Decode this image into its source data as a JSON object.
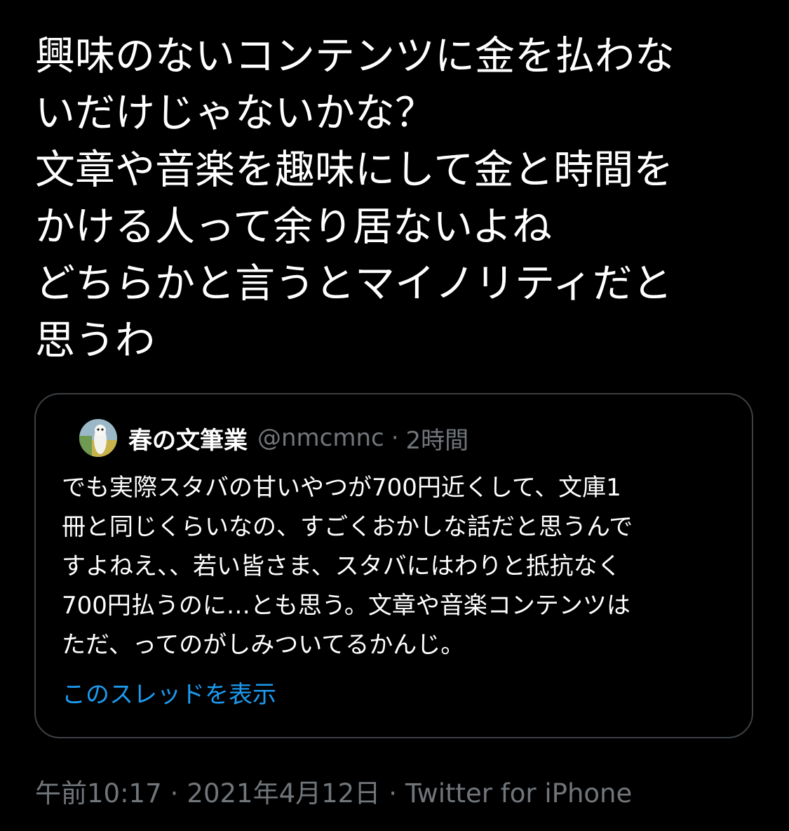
{
  "tweet": {
    "text_lines": [
      "興味のないコンテンツに金を払わな",
      "いだけじゃないかな？",
      "文章や音楽を趣味にして金と時間を",
      "かける人って余り居ないよね",
      "どちらかと言うとマイノリティだと",
      "思うわ"
    ]
  },
  "quote": {
    "author_name": "春の文筆業",
    "handle": "@nmcmnc",
    "separator": "·",
    "time": "2時間",
    "avatar_icon": "avatar-icon",
    "body_lines": [
      "でも実際スタバの甘いやつが700円近くして、文庫1",
      "冊と同じくらいなの、すごくおかしな話だと思うんで",
      "すよねえ、、若い皆さま、スタバにはわりと抵抗なく",
      "700円払うのに…とも思う。文章や音楽コンテンツは",
      "ただ、ってのがしみついてるかんじ。"
    ],
    "show_thread_label": "このスレッドを表示"
  },
  "meta": {
    "time": "午前10:17",
    "separator": "·",
    "date": "2021年4月12日",
    "source": "Twitter for iPhone"
  },
  "colors": {
    "background": "#000000",
    "text": "#ffffff",
    "secondary": "#71767b",
    "link": "#1d9bf0",
    "border": "#3c4044"
  }
}
